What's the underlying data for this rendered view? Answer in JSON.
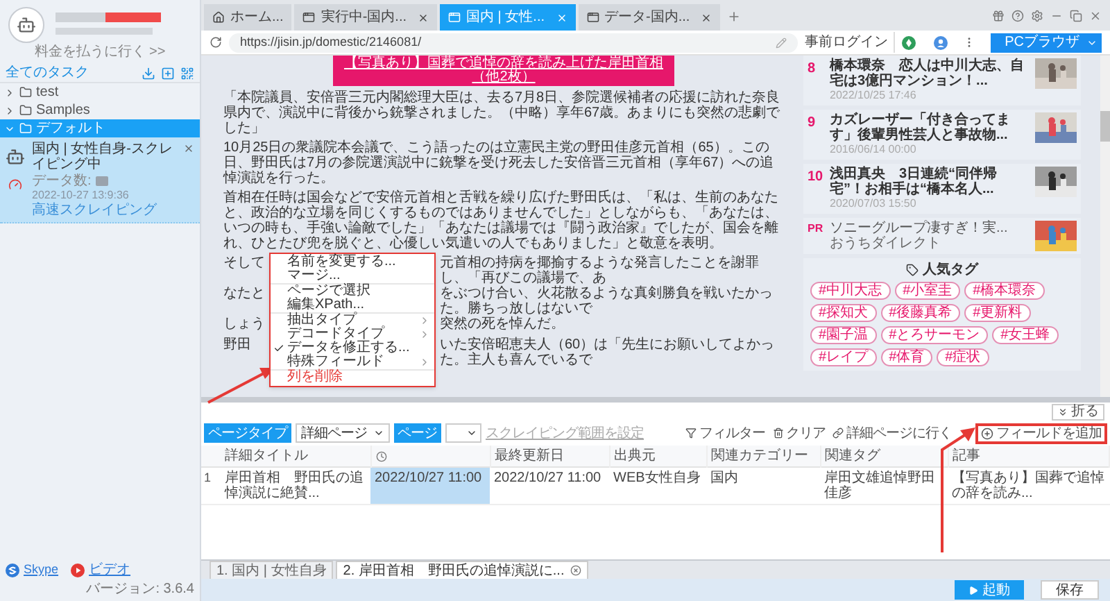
{
  "sidebar": {
    "pay_link": "料金を払うに行く >>",
    "all_tasks": "全てのタスク",
    "tree": [
      {
        "label": "test",
        "expanded": false,
        "selected": false
      },
      {
        "label": "Samples",
        "expanded": false,
        "selected": false
      },
      {
        "label": "デフォルト",
        "expanded": true,
        "selected": true,
        "children": [
          {
            "title": "国内 | 女性自身-スクレイピング中",
            "count_label": "データ数:",
            "date": "2022-10-27 13:9:36",
            "action": "高速スクレイピング"
          }
        ]
      }
    ],
    "footer": {
      "skype": "Skype",
      "video": "ビデオ",
      "version": "バージョン: 3.6.4"
    }
  },
  "tabs": [
    {
      "label": "ホーム...",
      "kind": "home",
      "selected": false
    },
    {
      "label": "実行中-国内...",
      "kind": "page",
      "selected": false
    },
    {
      "label": "国内 | 女性...",
      "kind": "page",
      "selected": true
    },
    {
      "label": "データ-国内...",
      "kind": "page",
      "selected": false
    }
  ],
  "address_bar": {
    "url": "https://jisin.jp/domestic/2146081/",
    "login": "事前ログイン",
    "browser_button": "PCブラウザ"
  },
  "article": {
    "banner": [
      "【写真あり】国葬で追悼の辞を読み上げた岸田首相",
      "（他2枚）"
    ],
    "paragraphs": [
      "「本院議員、安倍晋三元内閣総理大臣は、去る7月8日、参院選候補者の応援に訪れた奈良県内で、演説中に背後から銃撃されました。（中略）享年67歳。あまりにも突然の悲劇でした」",
      "10月25日の衆議院本会議で、こう語ったのは立憲民主党の野田佳彦元首相（65）。この日、野田氏は7月の参院選演説中に銃撃を受け死去した安倍晋三元首相（享年67）への追悼演説を行った。",
      "首相在任時は国会などで安倍元首相と舌戦を繰り広げた野田氏は、「私は、生前のあなたと、政治的な立場を同じくするものではありませんでした」としながらも、「あなたは、いつの時も、手強い論敵でした」「あなたは議場では『闘う政治家』でしたが、国会を離れ、ひとたび兜を脱ぐと、心優しい気遣いの人でもありました」と敬意を表明。"
    ],
    "partial_lines": [
      {
        "left": "そして",
        "right": "元首相の持病を揶揄するような発言したことを謝罪し、「再びこの議場で、あ"
      },
      {
        "left": "なたと",
        "right": "をぶつけ合い、火花散るような真剣勝負を戦いたかった。勝ちっ放しはないで"
      },
      {
        "left": "しょう",
        "right": "突然の死を悼んだ。"
      },
      {
        "left": "野田",
        "right": "いた安倍昭恵夫人（60）は「先生にお願いしてよかった。主人も喜んでいるで"
      }
    ]
  },
  "ranking": [
    {
      "kind": "article",
      "rank": "8",
      "title": "橋本環奈　恋人は中川大志、自宅は3億円マンション！...",
      "date": "2022/10/25 17:46"
    },
    {
      "kind": "article",
      "rank": "9",
      "title": "カズレーザー「付き合ってます」後輩男性芸人と事故物...",
      "date": "2016/06/14 00:00"
    },
    {
      "kind": "article",
      "rank": "10",
      "title": "浅田真央　3日連続“同伴帰宅”！お相手は“橋本名人...",
      "date": "2020/07/03 15:50"
    },
    {
      "kind": "ad",
      "rank": "PR",
      "title": "ソニーグループ凄すぎ！実...",
      "date": "おうちダイレクト"
    }
  ],
  "tags": {
    "title": "人気タグ",
    "items": [
      "#中川大志",
      "#小室圭",
      "#橋本環奈",
      "#探知犬",
      "#後藤真希",
      "#更新料",
      "#園子温",
      "#とろサーモン",
      "#女王蜂",
      "#レイプ",
      "#体育",
      "#症状"
    ]
  },
  "context_menu": {
    "groups": [
      [
        {
          "label": "名前を変更する...",
          "kind": "action",
          "checked": false
        },
        {
          "label": "マージ...",
          "kind": "action",
          "checked": false
        }
      ],
      [
        {
          "label": "ページで選択",
          "kind": "action",
          "checked": false
        },
        {
          "label": "編集XPath...",
          "kind": "action",
          "checked": false
        }
      ],
      [
        {
          "label": "抽出タイプ",
          "kind": "submenu",
          "checked": false
        },
        {
          "label": "デコードタイプ",
          "kind": "submenu",
          "checked": false
        },
        {
          "label": "データを修正する...",
          "kind": "action",
          "checked": true
        },
        {
          "label": "特殊フィールド",
          "kind": "submenu",
          "checked": false
        }
      ],
      [
        {
          "label": "列を削除",
          "kind": "danger",
          "checked": false
        }
      ]
    ]
  },
  "bottom_panel": {
    "fold": "折る",
    "page_type": "ページタイプ",
    "page_select": "詳細ページ",
    "second_type": "ページ",
    "scrape_range": "スクレイピング範囲を設定",
    "filter": "フィルター",
    "clear": "クリア",
    "goto_detail": "詳細ページに行く",
    "add_field": "フィールドを追加",
    "table": {
      "columns": [
        {
          "label": "詳細タイトル"
        },
        {
          "kind": "icon"
        },
        {
          "label": "最終更新日"
        },
        {
          "label": "出典元"
        },
        {
          "label": "関連カテゴリー"
        },
        {
          "label": "関連タグ"
        },
        {
          "label": "記事"
        }
      ],
      "rows": [
        {
          "index": "1",
          "cells": [
            {
              "text": "岸田首相　野田氏の追悼演説に絶賛...",
              "selected": false
            },
            {
              "text": "2022/10/27 11:00",
              "selected": true
            },
            {
              "text": "2022/10/27 11:00",
              "selected": false
            },
            {
              "text": "WEB女性自身",
              "selected": false
            },
            {
              "text": "国内",
              "selected": false
            },
            {
              "text": "岸田文雄追悼野田佳彦",
              "selected": false
            },
            {
              "text": "【写真あり】国葬で追悼の辞を読み...",
              "selected": false
            }
          ]
        }
      ]
    }
  },
  "bottom_tabs": [
    {
      "label": "1. 国内 | 女性自身",
      "selected": false,
      "closable": false
    },
    {
      "label": "2. 岸田首相　野田氏の追悼演説に...",
      "selected": true,
      "closable": true
    }
  ],
  "footer": {
    "start": "起動",
    "save": "保存"
  }
}
